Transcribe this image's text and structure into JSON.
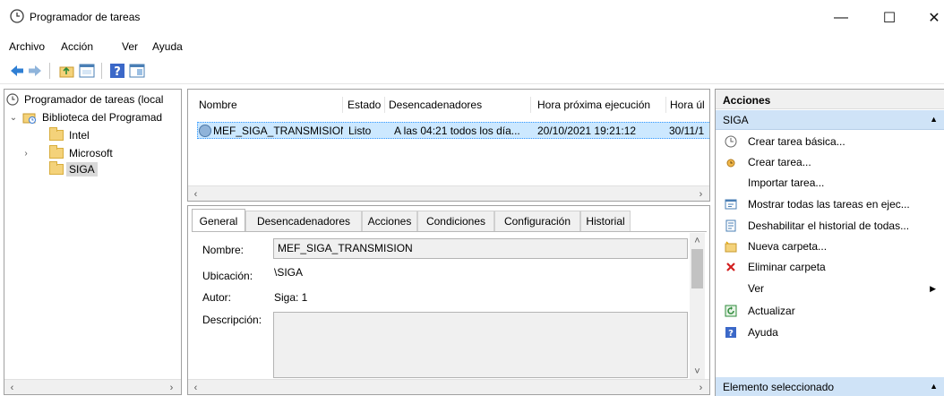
{
  "window": {
    "title": "Programador de tareas",
    "minimize": "—",
    "maximize": "☐",
    "close": "✕"
  },
  "menu": [
    "Archivo",
    "Acción",
    "Ver",
    "Ayuda"
  ],
  "toolbar_icons": [
    "back-arrow-icon",
    "forward-arrow-icon",
    "folder-up-icon",
    "properties-icon",
    "help-icon",
    "console-icon"
  ],
  "tree": {
    "root": "Programador de tareas (local",
    "library": "Biblioteca del Programad",
    "folders": [
      "Intel",
      "Microsoft",
      "SIGA"
    ]
  },
  "task_list": {
    "columns": [
      "Nombre",
      "Estado",
      "Desencadenadores",
      "Hora próxima ejecución",
      "Hora úl"
    ],
    "rows": [
      [
        "MEF_SIGA_TRANSMISION",
        "Listo",
        "A las 04:21 todos los día...",
        "20/10/2021 19:21:12",
        "30/11/1"
      ]
    ]
  },
  "detail": {
    "tabs": [
      "General",
      "Desencadenadores",
      "Acciones",
      "Condiciones",
      "Configuración",
      "Historial"
    ],
    "active_tab": "General",
    "fields": {
      "name_label": "Nombre:",
      "name_value": "MEF_SIGA_TRANSMISION",
      "location_label": "Ubicación:",
      "location_value": "\\SIGA",
      "author_label": "Autor:",
      "author_value": "Siga: 1",
      "description_label": "Descripción:",
      "description_value": ""
    }
  },
  "actions": {
    "header": "Acciones",
    "group1": "SIGA",
    "items": [
      {
        "label": "Crear tarea básica...",
        "icon": "basic-task-icon"
      },
      {
        "label": "Crear tarea...",
        "icon": "create-task-icon"
      },
      {
        "label": "Importar tarea...",
        "icon": ""
      },
      {
        "label": "Mostrar todas las tareas en ejec...",
        "icon": "running-tasks-icon"
      },
      {
        "label": "Deshabilitar el historial de todas...",
        "icon": "history-icon"
      },
      {
        "label": "Nueva carpeta...",
        "icon": "new-folder-icon"
      },
      {
        "label": "Eliminar carpeta",
        "icon": "delete-icon"
      },
      {
        "label": "Ver",
        "icon": ""
      },
      {
        "label": "Actualizar",
        "icon": "refresh-icon"
      },
      {
        "label": "Ayuda",
        "icon": "help-icon"
      }
    ],
    "group2": "Elemento seleccionado"
  },
  "colors": {
    "selection": "#cce8ff",
    "group_header": "#cfe3f7",
    "delete_red": "#d21f1f"
  }
}
